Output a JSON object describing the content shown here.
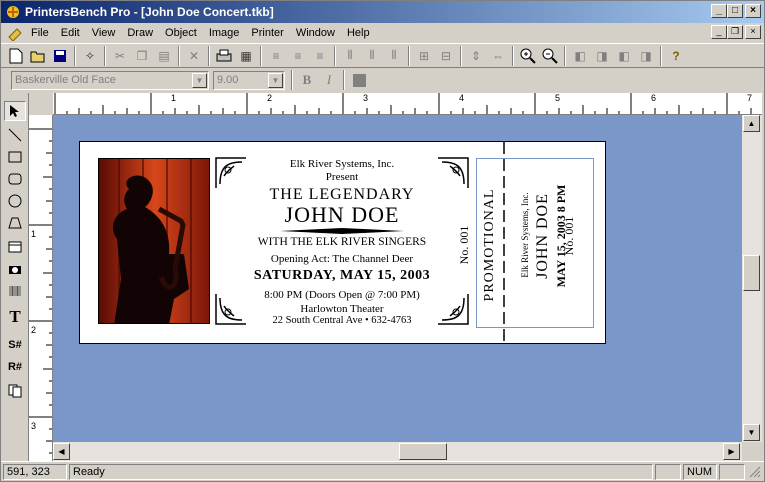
{
  "window": {
    "title": "PrintersBench Pro - [John Doe Concert.tkb]"
  },
  "menu": [
    "File",
    "Edit",
    "View",
    "Draw",
    "Object",
    "Image",
    "Printer",
    "Window",
    "Help"
  ],
  "fontbar": {
    "font_name": "Baskerville Old Face",
    "font_size": "9.00",
    "bold_label": "B",
    "italic_label": "I"
  },
  "rulers": {
    "h_labels": [
      "1",
      "2",
      "3",
      "4",
      "5",
      "6",
      "7"
    ],
    "v_labels": [
      "1",
      "2",
      "3"
    ]
  },
  "ticket": {
    "company": "Elk River Systems, Inc.",
    "present": "Present",
    "headline1": "THE LEGENDARY",
    "headline2": "JOHN DOE",
    "with": "WITH THE ELK RIVER SINGERS",
    "opening": "Opening Act: The Channel Deer",
    "date": "SATURDAY, MAY 15, 2003",
    "time": "8:00 PM (Doors Open @ 7:00 PM)",
    "venue": "Harlowton Theater",
    "address": "22 South Central Ave  •  632-4763",
    "number": "No.  001",
    "promo": "PROMOTIONAL",
    "stub_company": "Elk River Systems, Inc.",
    "stub_name": "JOHN DOE",
    "stub_date": "MAY 15, 2003  8 PM",
    "stub_number": "No.  001"
  },
  "status": {
    "coords": "591, 323",
    "state": "Ready",
    "num": "NUM"
  },
  "colors": {
    "canvas": "#7b97c9",
    "title_start": "#0a246a",
    "title_end": "#a6caf0"
  }
}
